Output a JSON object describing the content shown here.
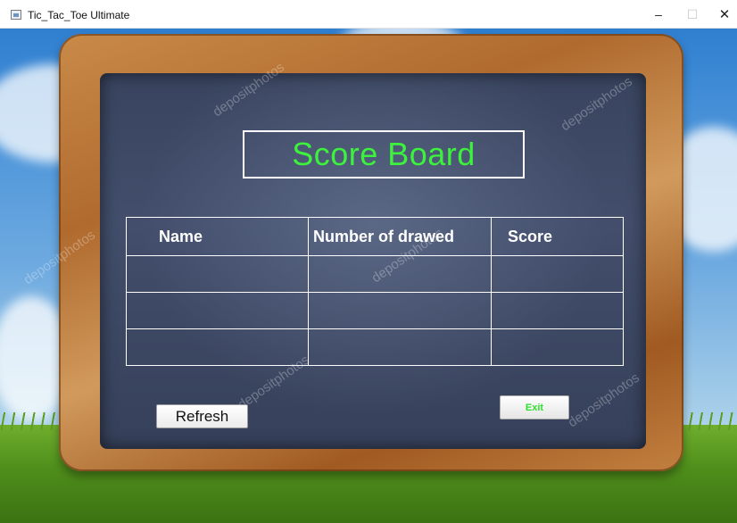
{
  "window": {
    "title": "Tic_Tac_Toe Ultimate",
    "minimize_glyph": "–",
    "maximize_glyph": "☐",
    "close_glyph": "✕"
  },
  "scoreboard": {
    "title": "Score Board",
    "columns": [
      "Name",
      "Number of drawed",
      "Score"
    ],
    "rows": [
      [
        "",
        "",
        ""
      ],
      [
        "",
        "",
        ""
      ],
      [
        "",
        "",
        ""
      ]
    ]
  },
  "buttons": {
    "refresh_label": "Refresh",
    "exit_label": "Exit"
  },
  "watermark": "depositphotos",
  "colors": {
    "title_green": "#3df23d",
    "exit_green": "#2ee02e",
    "chalkboard": "#3b4660"
  },
  "icons": {
    "app": "java-cup-icon",
    "minimize": "minimize-icon",
    "maximize": "maximize-icon",
    "close": "close-icon"
  }
}
